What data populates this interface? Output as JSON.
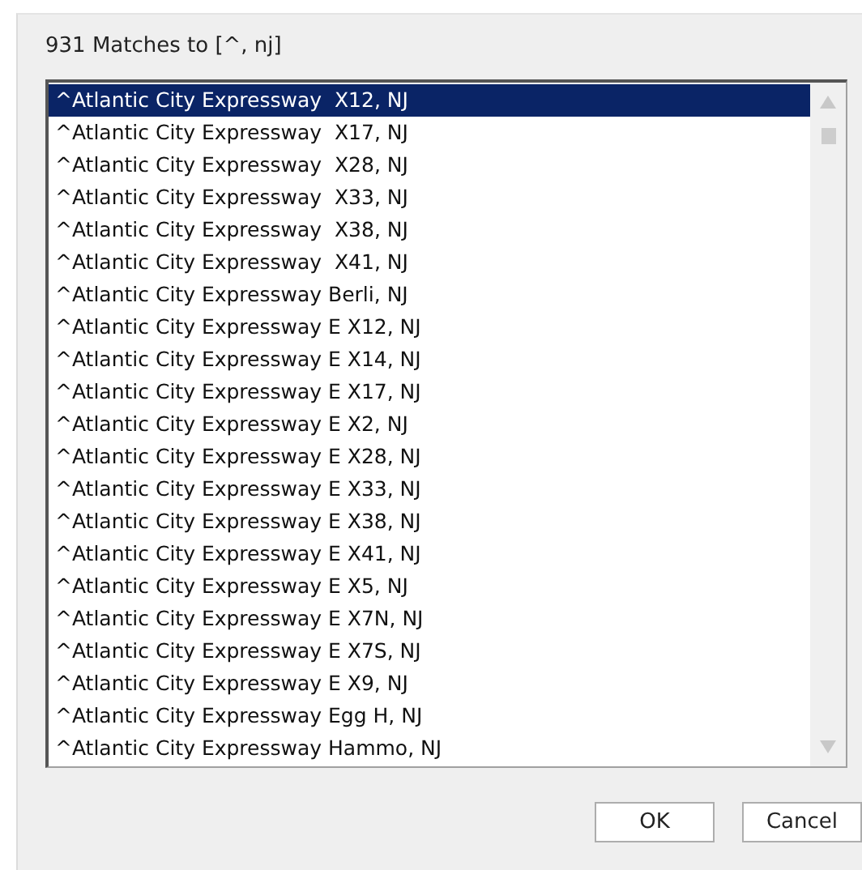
{
  "dialog": {
    "heading": "931 Matches to [^, nj]",
    "items": [
      {
        "label": "^Atlantic City Expressway  X12, NJ",
        "selected": true
      },
      {
        "label": "^Atlantic City Expressway  X17, NJ",
        "selected": false
      },
      {
        "label": "^Atlantic City Expressway  X28, NJ",
        "selected": false
      },
      {
        "label": "^Atlantic City Expressway  X33, NJ",
        "selected": false
      },
      {
        "label": "^Atlantic City Expressway  X38, NJ",
        "selected": false
      },
      {
        "label": "^Atlantic City Expressway  X41, NJ",
        "selected": false
      },
      {
        "label": "^Atlantic City Expressway Berli, NJ",
        "selected": false
      },
      {
        "label": "^Atlantic City Expressway E X12, NJ",
        "selected": false
      },
      {
        "label": "^Atlantic City Expressway E X14, NJ",
        "selected": false
      },
      {
        "label": "^Atlantic City Expressway E X17, NJ",
        "selected": false
      },
      {
        "label": "^Atlantic City Expressway E X2, NJ",
        "selected": false
      },
      {
        "label": "^Atlantic City Expressway E X28, NJ",
        "selected": false
      },
      {
        "label": "^Atlantic City Expressway E X33, NJ",
        "selected": false
      },
      {
        "label": "^Atlantic City Expressway E X38, NJ",
        "selected": false
      },
      {
        "label": "^Atlantic City Expressway E X41, NJ",
        "selected": false
      },
      {
        "label": "^Atlantic City Expressway E X5, NJ",
        "selected": false
      },
      {
        "label": "^Atlantic City Expressway E X7N, NJ",
        "selected": false
      },
      {
        "label": "^Atlantic City Expressway E X7S, NJ",
        "selected": false
      },
      {
        "label": "^Atlantic City Expressway E X9, NJ",
        "selected": false
      },
      {
        "label": "^Atlantic City Expressway Egg H, NJ",
        "selected": false
      },
      {
        "label": "^Atlantic City Expressway Hammo, NJ",
        "selected": false
      }
    ],
    "buttons": [
      "OK",
      "Cancel"
    ]
  }
}
